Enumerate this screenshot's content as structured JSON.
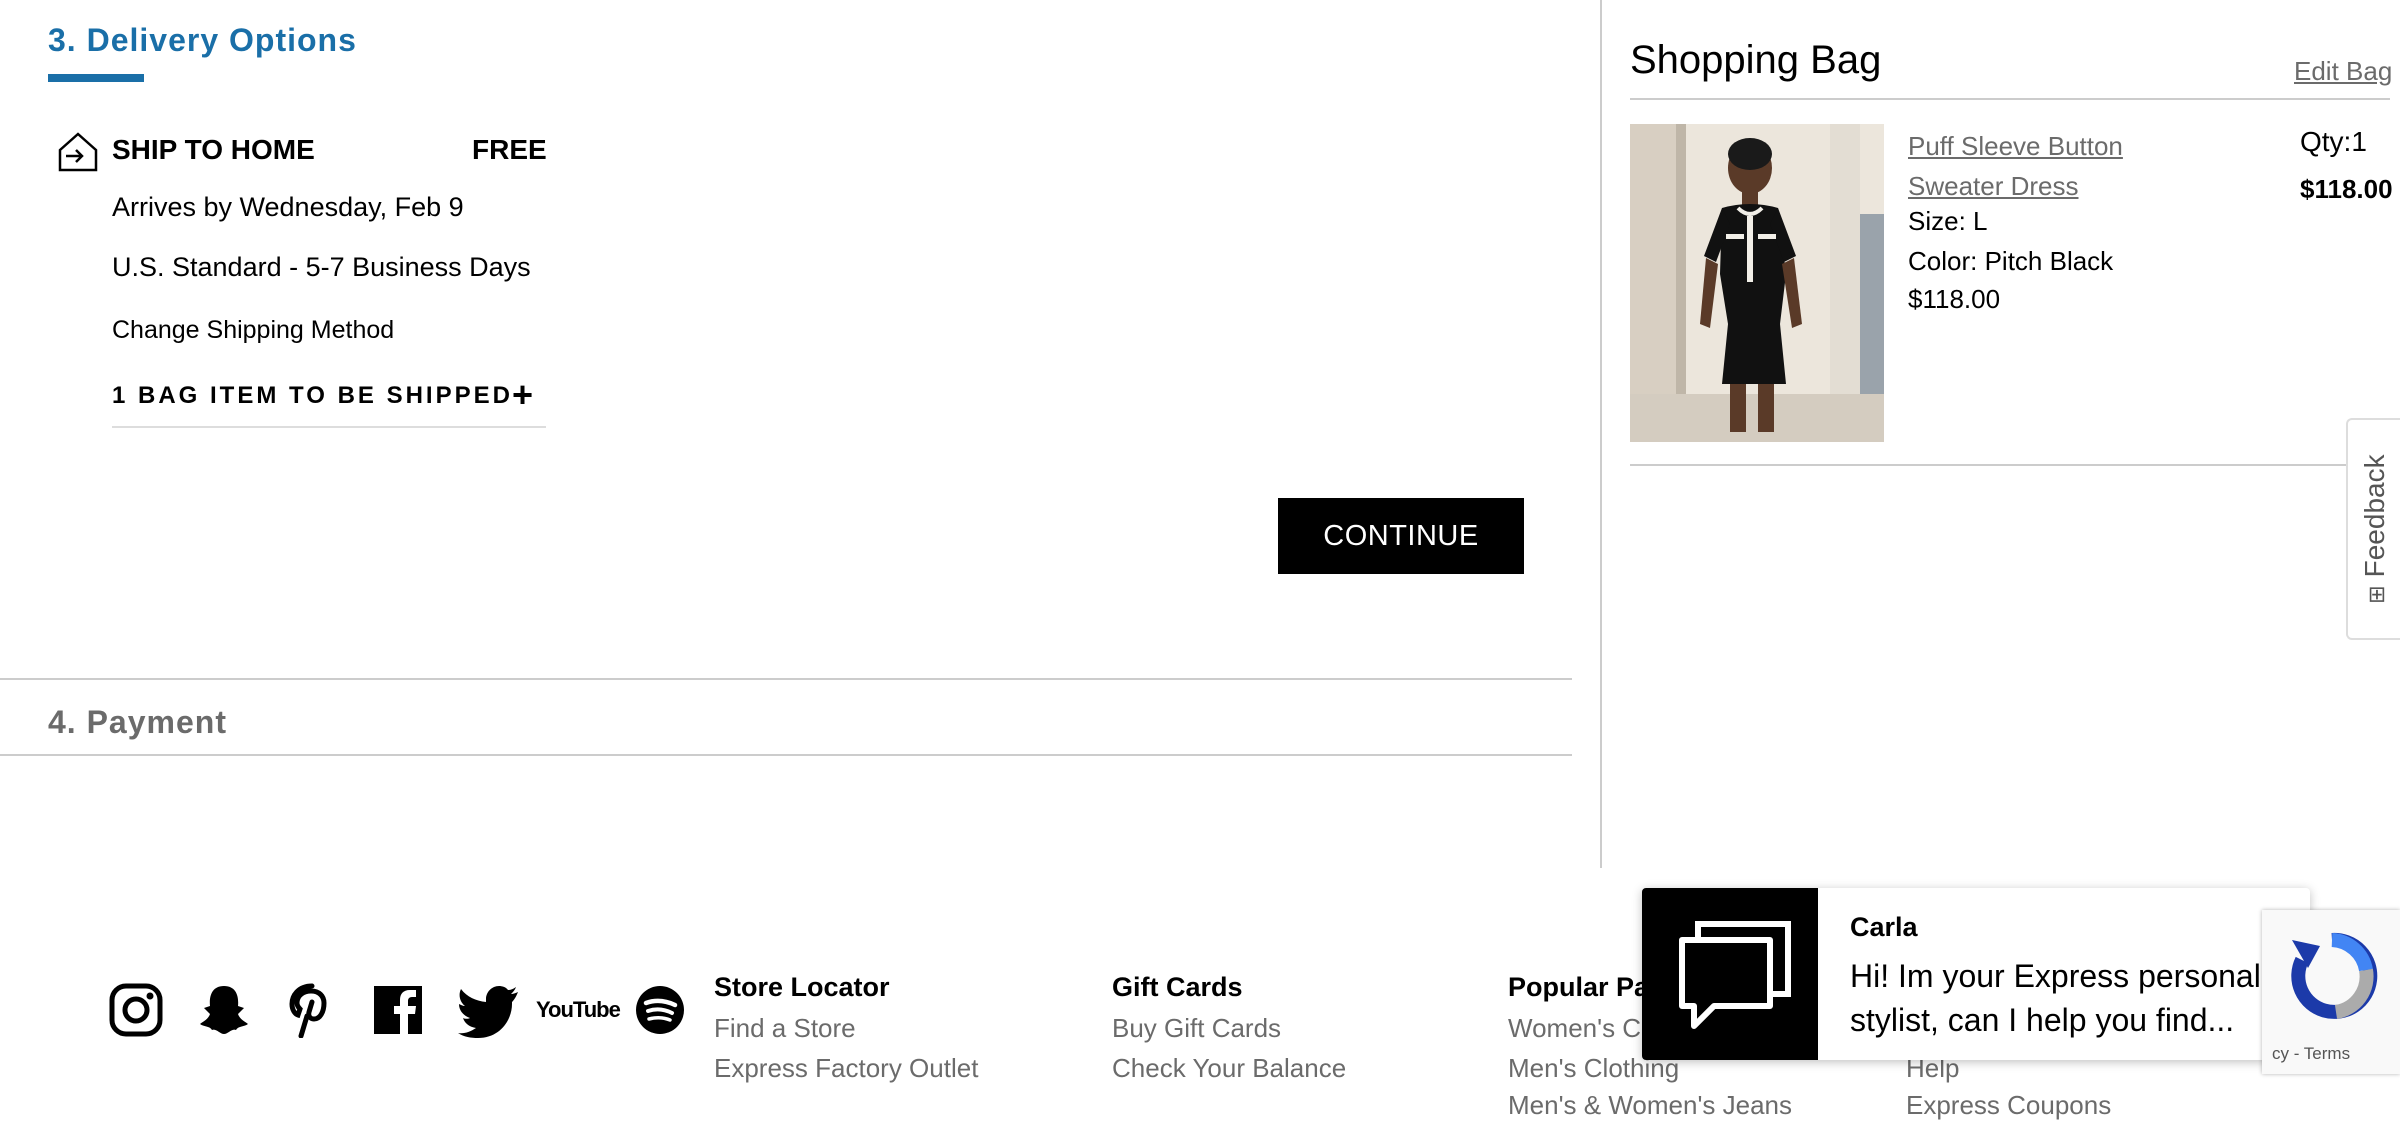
{
  "delivery": {
    "step_title": "3. Delivery Options",
    "ship_label": "SHIP TO HOME",
    "ship_price": "FREE",
    "arrives": "Arrives by Wednesday, Feb 9",
    "method": "U.S. Standard - 5-7 Business Days",
    "change_method": "Change Shipping Method",
    "bag_items": "1 BAG ITEM TO BE SHIPPED",
    "bag_items_toggle": "+",
    "continue": "CONTINUE"
  },
  "payment": {
    "step_title": "4. Payment"
  },
  "bag": {
    "title": "Shopping Bag",
    "edit": "Edit Bag",
    "item": {
      "name": "Puff Sleeve Button Sweater Dress",
      "size": "Size: L",
      "color": "Color: Pitch Black",
      "price": "$118.00",
      "qty": "Qty:1",
      "total": "$118.00"
    }
  },
  "feedback": {
    "label": "Feedback"
  },
  "footer": {
    "social_icons": [
      "instagram-icon",
      "snapchat-icon",
      "pinterest-icon",
      "facebook-icon",
      "twitter-icon",
      "youtube-icon",
      "spotify-icon"
    ],
    "youtube_text": "YouTube",
    "col1": {
      "heading": "Store Locator",
      "links": [
        "Find a Store",
        "Express Factory Outlet"
      ]
    },
    "col2": {
      "heading": "Gift Cards",
      "links": [
        "Buy Gift Cards",
        "Check Your Balance"
      ]
    },
    "col3": {
      "heading": "Popular Pa",
      "links": [
        "Women's C",
        "Men's Clothing",
        "Men's & Women's Jeans"
      ]
    },
    "col4": {
      "links": [
        "Help",
        "Express Coupons"
      ]
    }
  },
  "chat": {
    "name": "Carla",
    "message": "Hi! Im your Express personal stylist, can I help you find..."
  },
  "recaptcha": {
    "text": "cy - Terms"
  },
  "colors": {
    "accent": "#1a6fa8",
    "muted": "#6b6b6b",
    "button": "#000000"
  }
}
